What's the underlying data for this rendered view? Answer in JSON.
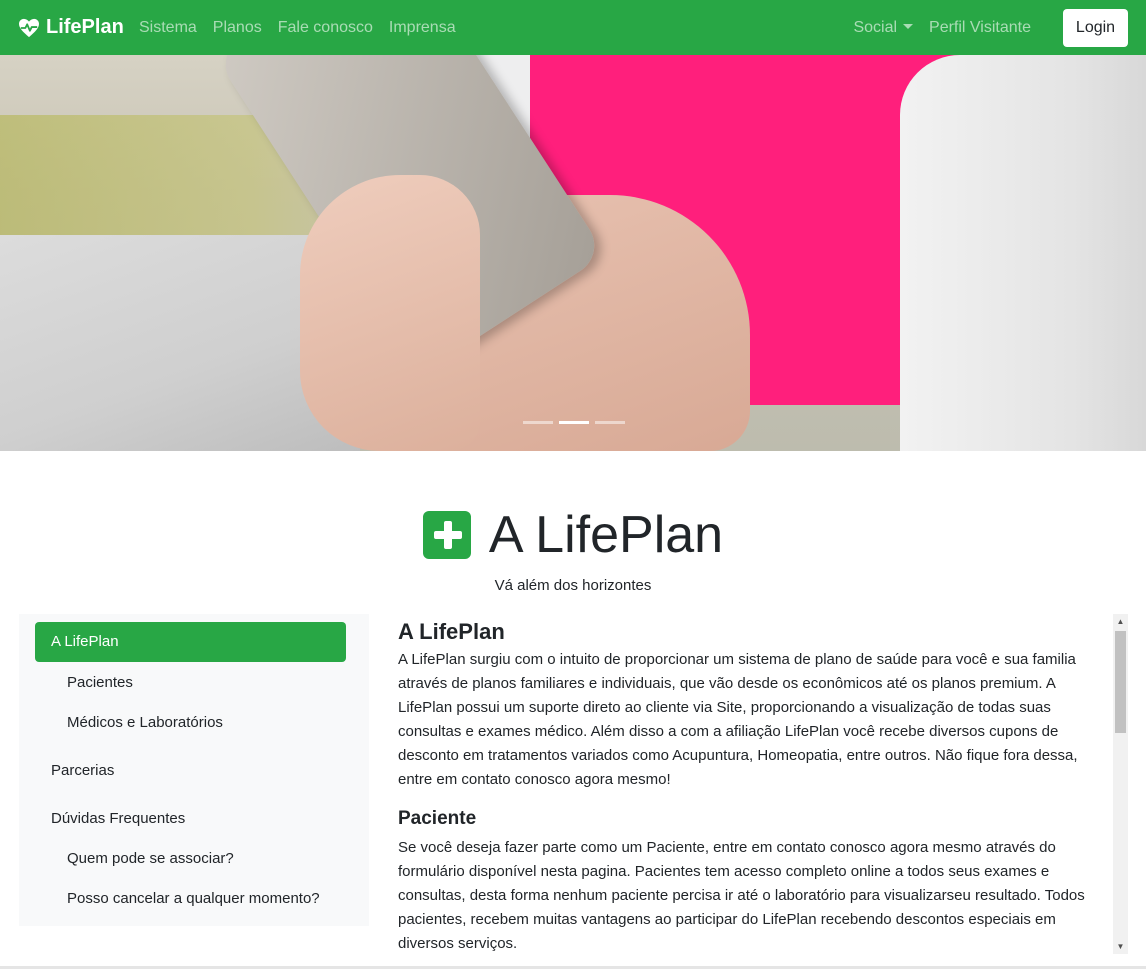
{
  "navbar": {
    "brand": "LifePlan",
    "links": [
      "Sistema",
      "Planos",
      "Fale conosco",
      "Imprensa"
    ],
    "social": "Social",
    "profile": "Perfil Visitante",
    "login": "Login",
    "color": "#28a745"
  },
  "carousel": {
    "slide_count": 3,
    "active_index": 1
  },
  "hero": {
    "title": "A LifePlan",
    "subtitle": "Vá além dos horizontes"
  },
  "sidebar": {
    "items": [
      {
        "label": "A LifePlan",
        "active": true
      },
      {
        "label": "Pacientes"
      },
      {
        "label": "Médicos e Laboratórios"
      },
      {
        "label": "Parcerias"
      },
      {
        "label": "Dúvidas Frequentes"
      },
      {
        "label": "Quem pode se associar?"
      },
      {
        "label": "Posso cancelar a qualquer momento?"
      }
    ]
  },
  "content": {
    "section1_title": "A LifePlan",
    "section1_text": "A LifePlan surgiu com o intuito de proporcionar um sistema de plano de saúde para você e sua familia através de planos familiares e individuais, que vão desde os econômicos até os planos premium. A LifePlan possui um suporte direto ao cliente via Site, proporcionando a visualização de todas suas consultas e exames médico. Além disso a com a afiliação LifePlan você recebe diversos cupons de desconto em tratamentos variados como Acupuntura, Homeopatia, entre outros. Não fique fora dessa, entre em contato conosco agora mesmo!",
    "section2_title": "Paciente",
    "section2_text": "Se você deseja fazer parte como um Paciente, entre em contato conosco agora mesmo através do formulário disponível nesta pagina. Pacientes tem acesso completo online a todos seus exames e consultas, desta forma nenhum paciente percisa ir até o laboratório para visualizarseu resultado. Todos pacientes, recebem muitas vantagens ao participar do LifePlan recebendo descontos especiais em diversos serviços."
  }
}
